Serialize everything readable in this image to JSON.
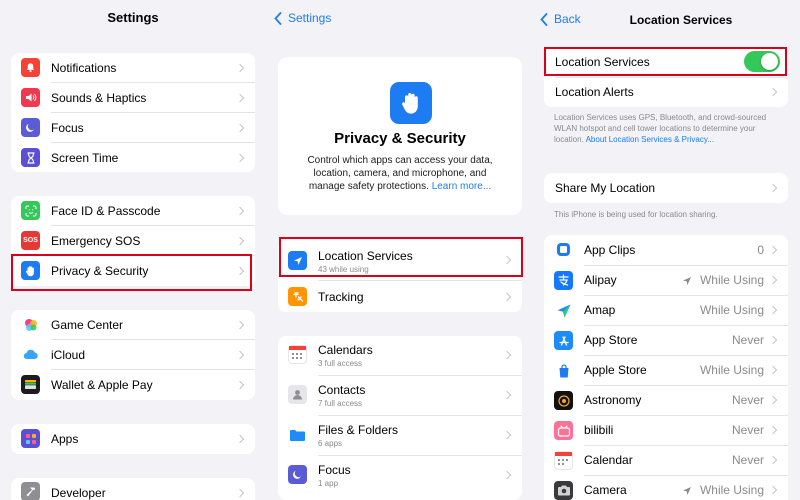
{
  "colors": {
    "accent": "#1e7cf2",
    "highlight": "#d9001b",
    "toggle_on": "#34c759",
    "background": "#f2f2f7"
  },
  "settings_panel": {
    "title": "Settings",
    "group1": [
      {
        "label": "Notifications",
        "icon": "bell-icon",
        "color": "#f44336"
      },
      {
        "label": "Sounds & Haptics",
        "icon": "speaker-icon",
        "color": "#f2384e"
      },
      {
        "label": "Focus",
        "icon": "moon-icon",
        "color": "#5b5bd6"
      },
      {
        "label": "Screen Time",
        "icon": "hourglass-icon",
        "color": "#5b4fd6"
      }
    ],
    "group2": [
      {
        "label": "Face ID & Passcode",
        "icon": "face-id-icon",
        "color": "#34c759"
      },
      {
        "label": "Emergency SOS",
        "icon": "sos-icon",
        "color": "#e53935",
        "icon_text": "SOS"
      },
      {
        "label": "Privacy & Security",
        "icon": "hand-icon",
        "color": "#1e7cf2"
      }
    ],
    "group3": [
      {
        "label": "Game Center",
        "icon": "game-center-icon",
        "color": "#ffffff"
      },
      {
        "label": "iCloud",
        "icon": "cloud-icon",
        "color": "#ffffff"
      },
      {
        "label": "Wallet & Apple Pay",
        "icon": "wallet-icon",
        "color": "#1c1c1e"
      }
    ],
    "group4": [
      {
        "label": "Apps",
        "icon": "apps-grid-icon",
        "color": "#5b4fd6"
      }
    ],
    "group5": [
      {
        "label": "Developer",
        "icon": "hammer-icon",
        "color": "#8e8e93"
      }
    ]
  },
  "privacy_panel": {
    "back_label": "Settings",
    "hero_title": "Privacy & Security",
    "hero_description": "Control which apps can access your data, location, camera, and microphone, and manage safety protections.",
    "hero_link": "Learn more...",
    "group1": [
      {
        "label": "Location Services",
        "sub": "43 while using",
        "icon": "location-arrow-icon",
        "color": "#1e7cf2"
      },
      {
        "label": "Tracking",
        "sub": "",
        "icon": "tracking-icon",
        "color": "#ff9500"
      }
    ],
    "group2": [
      {
        "label": "Calendars",
        "sub": "3 full access",
        "icon": "calendar-icon",
        "color": "#ffffff"
      },
      {
        "label": "Contacts",
        "sub": "7 full access",
        "icon": "contacts-icon",
        "color": "#e5e5ea"
      },
      {
        "label": "Files & Folders",
        "sub": "6 apps",
        "icon": "folder-icon",
        "color": "#ffffff"
      },
      {
        "label": "Focus",
        "sub": "1 app",
        "icon": "moon-icon",
        "color": "#5b5bd6"
      }
    ]
  },
  "location_panel": {
    "back_label": "Back",
    "title": "Location Services",
    "toggle_label": "Location Services",
    "toggle_on": true,
    "alerts_label": "Location Alerts",
    "note1": "Location Services uses GPS, Bluetooth, and crowd-sourced WLAN hotspot and cell tower locations to determine your location.",
    "note1_link": "About Location Services & Privacy...",
    "share_label": "Share My Location",
    "note2": "This iPhone is being used for location sharing.",
    "apps": [
      {
        "label": "App Clips",
        "value": "0",
        "arrow": false,
        "icon": "app-clips-icon",
        "color": "#1e7cf2"
      },
      {
        "label": "Alipay",
        "value": "While Using",
        "arrow": true,
        "icon": "alipay-icon",
        "color": "#1677ff"
      },
      {
        "label": "Amap",
        "value": "While Using",
        "arrow": false,
        "icon": "amap-icon",
        "color": "#ffffff"
      },
      {
        "label": "App Store",
        "value": "Never",
        "arrow": false,
        "icon": "app-store-icon",
        "color": "#1e8cf8"
      },
      {
        "label": "Apple Store",
        "value": "While Using",
        "arrow": false,
        "icon": "apple-store-icon",
        "color": "#1e7cf2"
      },
      {
        "label": "Astronomy",
        "value": "Never",
        "arrow": false,
        "icon": "astronomy-icon",
        "color": "#111111"
      },
      {
        "label": "bilibili",
        "value": "Never",
        "arrow": false,
        "icon": "bilibili-icon",
        "color": "#fb7299"
      },
      {
        "label": "Calendar",
        "value": "Never",
        "arrow": false,
        "icon": "calendar-icon",
        "color": "#ffffff"
      },
      {
        "label": "Camera",
        "value": "While Using",
        "arrow": true,
        "icon": "camera-icon",
        "color": "#3a3a3c"
      }
    ]
  }
}
